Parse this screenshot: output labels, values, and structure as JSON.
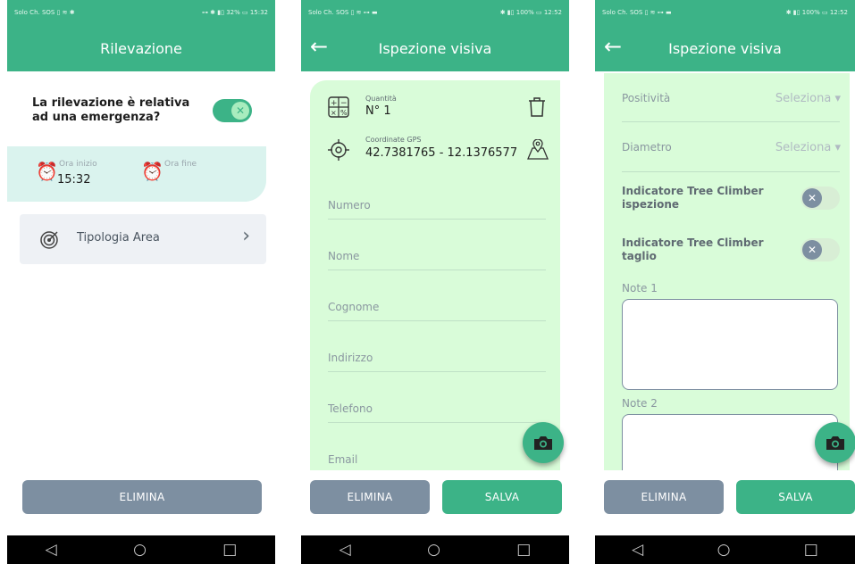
{
  "screen1": {
    "status_left": "Solo Ch. SOS ▯ ≋ ✱",
    "status_right": "⊶ ✱ ▮▯ 32% ▭ 15:32",
    "title": "Rilevazione",
    "emergency_label": "La rilevazione è relativa ad una emergenza?",
    "emergency_on": true,
    "start_label": "Ora inizio",
    "start_value": "15:32",
    "end_label": "Ora fine",
    "end_value": "",
    "area_label": "Tipologia Area",
    "area_chevron": "›",
    "delete_label": "ELIMINA"
  },
  "screen2": {
    "status_left": "Solo Ch. SOS ▯ ≋ ⊶ ▬",
    "status_right": "✱ ▮▯ 100% ▭ 12:52",
    "title": "Ispezione visiva",
    "back": "←",
    "quantity_label": "Quantità",
    "quantity_value": "N° 1",
    "gps_label": "Coordinate GPS",
    "gps_value": "42.7381765 - 12.1376577",
    "fields": [
      "Numero",
      "Nome",
      "Cognome",
      "Indirizzo",
      "Telefono",
      "Email"
    ],
    "delete_label": "ELIMINA",
    "save_label": "SALVA"
  },
  "screen3": {
    "status_left": "Solo Ch. SOS ▯ ≋ ⊶ ▬",
    "status_right": "✱ ▮▯ 100% ▭ 12:52",
    "title": "Ispezione visiva",
    "back": "←",
    "positivity_label": "Positività",
    "positivity_value": "Seleziona ▾",
    "diameter_label": "Diametro",
    "diameter_value": "Seleziona ▾",
    "tc_inspection_label": "Indicatore Tree Climber ispezione",
    "tc_cut_label": "Indicatore Tree Climber taglio",
    "tc_inspection_on": false,
    "tc_cut_on": false,
    "note1_label": "Note 1",
    "note2_label": "Note 2",
    "delete_label": "ELIMINA",
    "save_label": "SALVA"
  },
  "nav": {
    "back": "◁",
    "home": "○",
    "recent": "□"
  },
  "icons": [
    "alarm-clock-icon",
    "target-icon",
    "chevron-right-icon",
    "calculator-icon",
    "trash-icon",
    "crosshair-icon",
    "map-pin-icon",
    "camera-icon",
    "back-arrow-icon"
  ],
  "colors": {
    "primary": "#3cb387",
    "grey_button": "#7d8fa1",
    "form_background": "#d9fcd9",
    "time_background": "#daf3ee"
  }
}
